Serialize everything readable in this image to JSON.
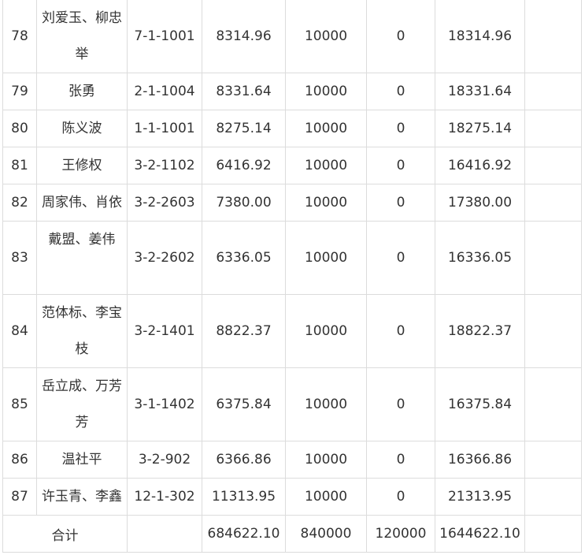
{
  "rows": [
    {
      "no": "78",
      "name": "刘爱玉、柳忠举",
      "room": "7-1-1001",
      "a": "8314.96",
      "b": "10000",
      "c": "0",
      "total": "18314.96",
      "extra": ""
    },
    {
      "no": "79",
      "name": "张勇",
      "room": "2-1-1004",
      "a": "8331.64",
      "b": "10000",
      "c": "0",
      "total": "18331.64",
      "extra": ""
    },
    {
      "no": "80",
      "name": "陈义波",
      "room": "1-1-1001",
      "a": "8275.14",
      "b": "10000",
      "c": "0",
      "total": "18275.14",
      "extra": ""
    },
    {
      "no": "81",
      "name": "王修权",
      "room": "3-2-1102",
      "a": "6416.92",
      "b": "10000",
      "c": "0",
      "total": "16416.92",
      "extra": ""
    },
    {
      "no": "82",
      "name": "周家伟、肖依",
      "room": "3-2-2603",
      "a": "7380.00",
      "b": "10000",
      "c": "0",
      "total": "17380.00",
      "extra": ""
    },
    {
      "no": "83",
      "name": "戴盟、姜伟",
      "room": "3-2-2602",
      "a": "6336.05",
      "b": "10000",
      "c": "0",
      "total": "16336.05",
      "extra": ""
    },
    {
      "no": "84",
      "name": "范体标、李宝枝",
      "room": "3-2-1401",
      "a": "8822.37",
      "b": "10000",
      "c": "0",
      "total": "18822.37",
      "extra": ""
    },
    {
      "no": "85",
      "name": "岳立成、万芳芳",
      "room": "3-1-1402",
      "a": "6375.84",
      "b": "10000",
      "c": "0",
      "total": "16375.84",
      "extra": ""
    },
    {
      "no": "86",
      "name": "温社平",
      "room": "3-2-902",
      "a": "6366.86",
      "b": "10000",
      "c": "0",
      "total": "16366.86",
      "extra": ""
    },
    {
      "no": "87",
      "name": "许玉青、李鑫",
      "room": "12-1-302",
      "a": "11313.95",
      "b": "10000",
      "c": "0",
      "total": "21313.95",
      "extra": ""
    }
  ],
  "summary": {
    "label": "合计",
    "room": "",
    "a": "684622.10",
    "b": "840000",
    "c": "120000",
    "total": "1644622.10",
    "extra": ""
  }
}
